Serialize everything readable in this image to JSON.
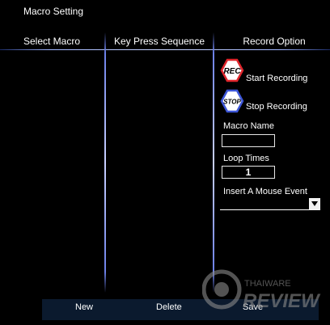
{
  "window": {
    "title": "Macro Setting"
  },
  "columns": {
    "select_macro": "Select Macro",
    "key_press_sequence": "Key Press Sequence",
    "record_option": "Record Option"
  },
  "record": {
    "rec_icon_text": "REC",
    "start_label": "Start Recording",
    "stop_icon_text": "STOP",
    "stop_label": "Stop Recording"
  },
  "macro_name": {
    "label": "Macro Name",
    "value": ""
  },
  "loop_times": {
    "label": "Loop Times",
    "value": "1"
  },
  "mouse_event": {
    "label": "Insert A Mouse Event",
    "selected": ""
  },
  "buttons": {
    "new": "New",
    "delete": "Delete",
    "save": "Save"
  },
  "watermark": {
    "line1": "THAIWARE",
    "line2": "REVIEW"
  },
  "colors": {
    "rec_border": "#e0252b",
    "stop_border": "#3d56d8",
    "divider": "#9fb4ff",
    "bottom_bar": "#0b1a2e"
  },
  "icons": [
    "rec-icon",
    "stop-icon",
    "dropdown-arrow-icon",
    "watermark-logo-icon"
  ]
}
